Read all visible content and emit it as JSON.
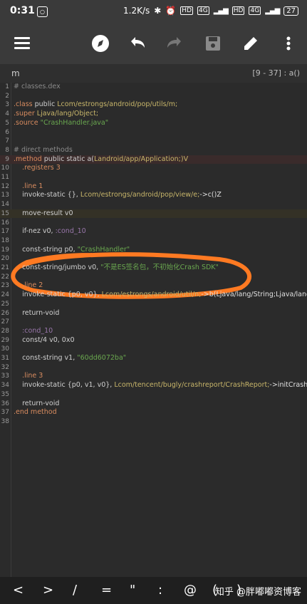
{
  "status_bar": {
    "time": "0:31",
    "speed": "1.2K/s",
    "hd1": "HD",
    "net1": "4G",
    "hd2": "HD",
    "net2": "4G",
    "battery": "27"
  },
  "toolbar": {
    "icons": [
      "menu-icon",
      "compass-icon",
      "undo-icon",
      "redo-icon",
      "save-icon",
      "edit-icon",
      "more-vert-icon"
    ]
  },
  "file": {
    "name": "m",
    "position": "[9 - 37] : a()"
  },
  "lines": [
    {
      "n": "1",
      "parts": [
        {
          "t": "# classes.dex",
          "c": "comment"
        }
      ]
    },
    {
      "n": "2",
      "parts": []
    },
    {
      "n": "3",
      "parts": [
        {
          "t": ".class ",
          "c": "dir"
        },
        {
          "t": "public ",
          "c": "plain"
        },
        {
          "t": "Lcom/estrongs/android/pop/utils/m;",
          "c": "type"
        }
      ]
    },
    {
      "n": "4",
      "parts": [
        {
          "t": ".super ",
          "c": "dir"
        },
        {
          "t": "Ljava/lang/Object;",
          "c": "type"
        }
      ]
    },
    {
      "n": "5",
      "parts": [
        {
          "t": ".source ",
          "c": "dir"
        },
        {
          "t": "\"CrashHandler.java\"",
          "c": "str"
        }
      ]
    },
    {
      "n": "6",
      "parts": []
    },
    {
      "n": "7",
      "parts": []
    },
    {
      "n": "8",
      "parts": [
        {
          "t": "# direct methods",
          "c": "comment"
        }
      ]
    },
    {
      "n": "9",
      "parts": [
        {
          "t": ".method ",
          "c": "dir"
        },
        {
          "t": "public static a(",
          "c": "plain"
        },
        {
          "t": "Landroid/app/Application;",
          "c": "type"
        },
        {
          "t": ")V",
          "c": "type"
        }
      ],
      "hl": "red"
    },
    {
      "n": "10",
      "parts": [
        {
          "t": "    .registers 3",
          "c": "dir"
        }
      ]
    },
    {
      "n": "11",
      "parts": []
    },
    {
      "n": "12",
      "parts": [
        {
          "t": "    .line 1",
          "c": "dir"
        }
      ]
    },
    {
      "n": "13",
      "parts": [
        {
          "t": "    invoke-static {}, ",
          "c": "plain"
        },
        {
          "t": "Lcom/estrongs/android/pop/view/e;",
          "c": "type"
        },
        {
          "t": "->c()Z",
          "c": "op"
        }
      ]
    },
    {
      "n": "14",
      "parts": []
    },
    {
      "n": "15",
      "parts": [
        {
          "t": "    move-result v0",
          "c": "plain"
        }
      ],
      "hl": "yellow"
    },
    {
      "n": "16",
      "parts": []
    },
    {
      "n": "17",
      "parts": [
        {
          "t": "    if-nez v0, ",
          "c": "plain"
        },
        {
          "t": ":cond_10",
          "c": "label"
        }
      ]
    },
    {
      "n": "18",
      "parts": []
    },
    {
      "n": "19",
      "parts": [
        {
          "t": "    const-string p0, ",
          "c": "plain"
        },
        {
          "t": "\"CrashHandler\"",
          "c": "str"
        }
      ]
    },
    {
      "n": "20",
      "parts": []
    },
    {
      "n": "21",
      "parts": [
        {
          "t": "    const-string/jumbo v0, ",
          "c": "plain"
        },
        {
          "t": "\"不是ES签名包，不初始化Crash SDK\"",
          "c": "str"
        }
      ]
    },
    {
      "n": "22",
      "parts": []
    },
    {
      "n": "23",
      "parts": [
        {
          "t": "    .line 2",
          "c": "dir"
        }
      ]
    },
    {
      "n": "24",
      "parts": [
        {
          "t": "    invoke-static {p0, v0}, ",
          "c": "plain"
        },
        {
          "t": "Lcom/estrongs/android/util/n;",
          "c": "type"
        },
        {
          "t": "->b(Ljava/lang/String;Ljava/lang/Stri",
          "c": "op"
        }
      ]
    },
    {
      "n": "25",
      "parts": []
    },
    {
      "n": "26",
      "parts": [
        {
          "t": "    return-void",
          "c": "plain"
        }
      ]
    },
    {
      "n": "27",
      "parts": []
    },
    {
      "n": "28",
      "parts": [
        {
          "t": "    :cond_10",
          "c": "label"
        }
      ]
    },
    {
      "n": "29",
      "parts": [
        {
          "t": "    const/4 v0, 0x0",
          "c": "plain"
        }
      ]
    },
    {
      "n": "30",
      "parts": []
    },
    {
      "n": "31",
      "parts": [
        {
          "t": "    const-string v1, ",
          "c": "plain"
        },
        {
          "t": "\"60dd6072ba\"",
          "c": "str"
        }
      ]
    },
    {
      "n": "32",
      "parts": []
    },
    {
      "n": "33",
      "parts": [
        {
          "t": "    .line 3",
          "c": "dir"
        }
      ]
    },
    {
      "n": "34",
      "parts": [
        {
          "t": "    invoke-static {p0, v1, v0}, ",
          "c": "plain"
        },
        {
          "t": "Lcom/tencent/bugly/crashreport/CrashReport;",
          "c": "type"
        },
        {
          "t": "->initCrashRepo",
          "c": "op"
        }
      ]
    },
    {
      "n": "35",
      "parts": []
    },
    {
      "n": "36",
      "parts": [
        {
          "t": "    return-void",
          "c": "plain"
        }
      ]
    },
    {
      "n": "37",
      "parts": [
        {
          "t": ".end method",
          "c": "dir"
        }
      ]
    },
    {
      "n": "38",
      "parts": []
    }
  ],
  "bottom_keys": [
    "<",
    ">",
    "/",
    "=",
    "\"",
    ":",
    "@",
    "(",
    ")"
  ],
  "watermark": "知乎 @胖嘟嘟资博客",
  "colors": {
    "annotation": "#ff7a22"
  }
}
